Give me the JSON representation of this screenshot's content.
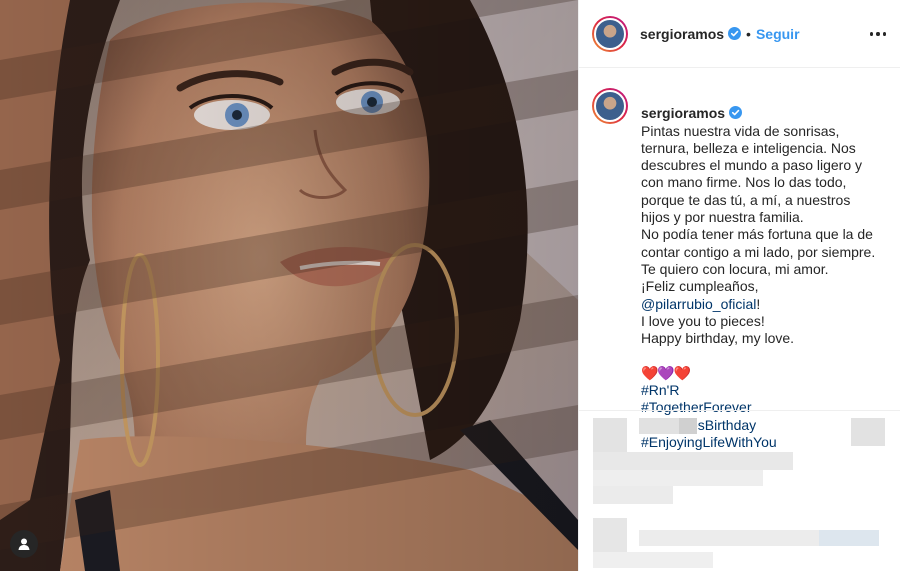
{
  "post": {
    "username": "sergioramos",
    "separator": "•",
    "follow_label": "Seguir",
    "caption": {
      "username": "sergioramos",
      "lines": [
        "Pintas nuestra vida de sonrisas, ternura, belleza e inteligencia. Nos descubres el mundo a paso ligero y con mano firme. Nos lo das todo, porque te das tú, a mí, a nuestros hijos y por nuestra familia.",
        "No podía tener más fortuna que la de contar contigo a mi lado, por siempre.",
        "Te quiero con locura, mi amor.",
        "¡Feliz cumpleaños,"
      ],
      "mention": "@pilarrubio_oficial",
      "mention_suffix": "!",
      "lines_after": [
        "I love you to pieces!",
        "Happy birthday, my love."
      ],
      "hearts": "❤️💜❤️",
      "hashtags_line1": [
        "#Rn'R",
        "#TogetherForever"
      ],
      "hashtags": [
        "#MyLovesBirthday",
        "#EnjoyingLifeWithYou"
      ]
    }
  },
  "colors": {
    "link_blue": "#3897f0",
    "hashtag_blue": "#003569",
    "text": "#262626"
  },
  "icons": {
    "verified": "verified-badge-icon",
    "more": "more-options-icon",
    "tag": "user-tag-icon"
  }
}
